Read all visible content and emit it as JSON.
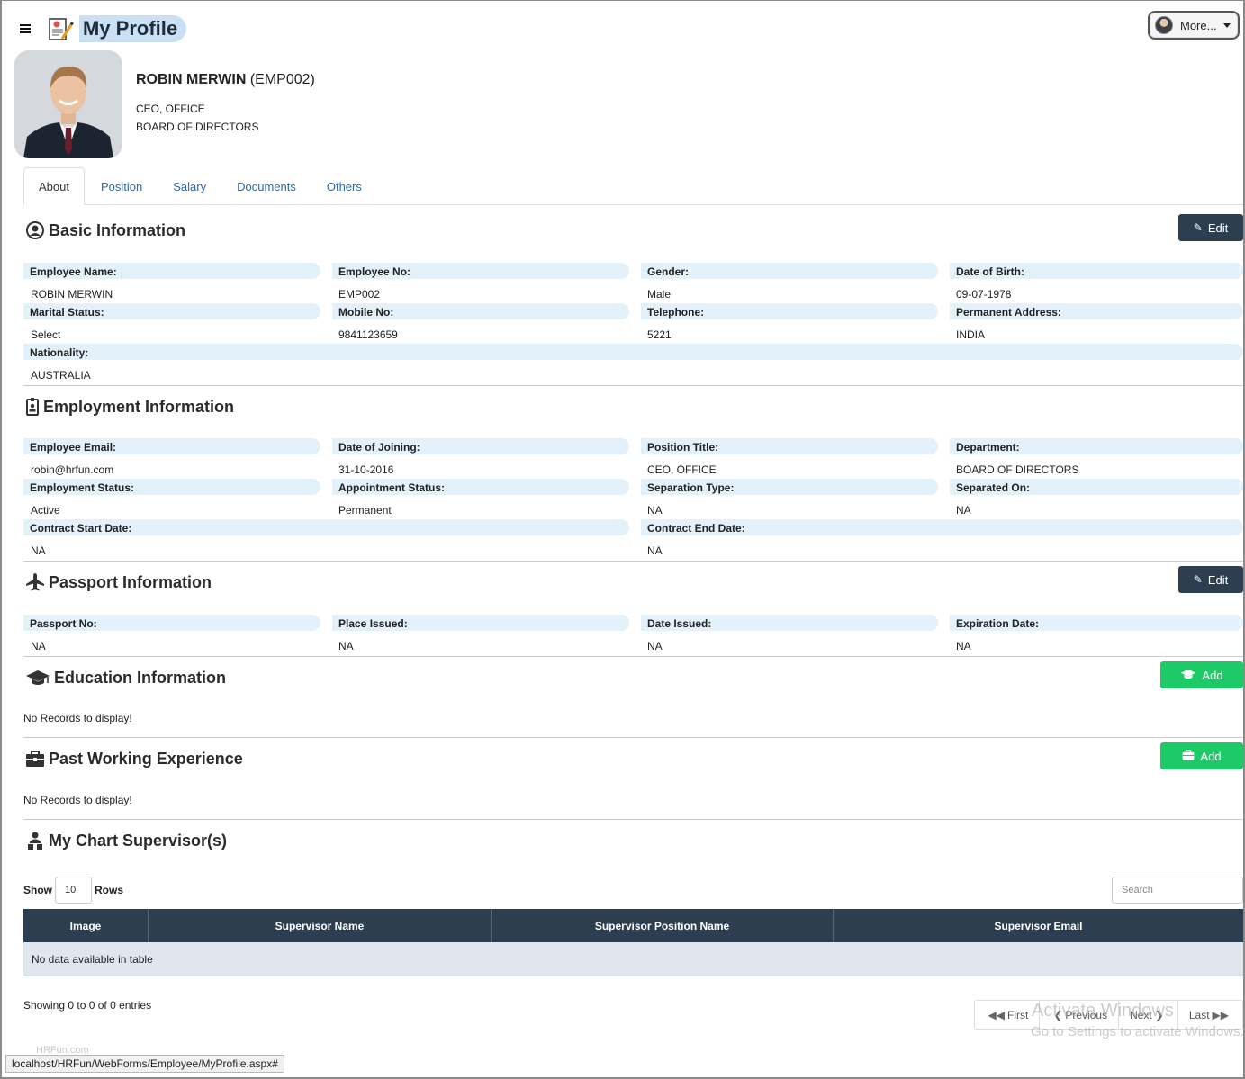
{
  "header": {
    "title": "My Profile",
    "more_label": "More..."
  },
  "profile": {
    "name": "ROBIN MERWIN",
    "emp_code": "(EMP002)",
    "position": "CEO, OFFICE",
    "department": "BOARD OF DIRECTORS"
  },
  "tabs": [
    {
      "label": "About",
      "active": true
    },
    {
      "label": "Position"
    },
    {
      "label": "Salary"
    },
    {
      "label": "Documents"
    },
    {
      "label": "Others"
    }
  ],
  "basic": {
    "title": "Basic Information",
    "edit_label": "Edit",
    "fields": [
      {
        "label": "Employee Name:",
        "value": "ROBIN MERWIN"
      },
      {
        "label": "Employee No:",
        "value": "EMP002"
      },
      {
        "label": "Gender:",
        "value": "Male"
      },
      {
        "label": "Date of Birth:",
        "value": "09-07-1978"
      },
      {
        "label": "Marital Status:",
        "value": "Select"
      },
      {
        "label": "Mobile No:",
        "value": "9841123659"
      },
      {
        "label": "Telephone:",
        "value": "5221"
      },
      {
        "label": "Permanent Address:",
        "value": "INDIA"
      },
      {
        "label": "Nationality:",
        "value": "AUSTRALIA"
      }
    ]
  },
  "employment": {
    "title": "Employment Information",
    "fields": [
      {
        "label": "Employee Email:",
        "value": "robin@hrfun.com"
      },
      {
        "label": "Date of Joining:",
        "value": "31-10-2016"
      },
      {
        "label": "Position Title:",
        "value": "CEO, OFFICE"
      },
      {
        "label": "Department:",
        "value": "BOARD OF DIRECTORS"
      },
      {
        "label": "Employment Status:",
        "value": "Active"
      },
      {
        "label": "Appointment Status:",
        "value": "Permanent"
      },
      {
        "label": "Separation Type:",
        "value": "NA"
      },
      {
        "label": "Separated On:",
        "value": "NA"
      },
      {
        "label": "Contract Start Date:",
        "value": "NA"
      },
      {
        "label": "Contract End Date:",
        "value": "NA"
      }
    ]
  },
  "passport": {
    "title": "Passport Information",
    "edit_label": "Edit",
    "fields": [
      {
        "label": "Passport No:",
        "value": "NA"
      },
      {
        "label": "Place Issued:",
        "value": "NA"
      },
      {
        "label": "Date Issued:",
        "value": "NA"
      },
      {
        "label": "Expiration Date:",
        "value": "NA"
      }
    ]
  },
  "education": {
    "title": "Education Information",
    "add_label": "Add",
    "empty": "No Records to display!"
  },
  "experience": {
    "title": "Past Working Experience",
    "add_label": "Add",
    "empty": "No Records to display!"
  },
  "supervisors": {
    "title": "My Chart Supervisor(s)",
    "show_label": "Show",
    "rows_value": "10",
    "rows_label": "Rows",
    "search_placeholder": "Search",
    "columns": [
      "Image",
      "Supervisor Name",
      "Supervisor Position Name",
      "Supervisor Email"
    ],
    "empty": "No data available in table",
    "showing": "Showing 0 to 0 of 0 entries",
    "pager": {
      "first": "First",
      "previous": "Previous",
      "next": "Next",
      "last": "Last"
    }
  },
  "overlay": {
    "watermark_line1": "Activate Windows",
    "watermark_line2": "Go to Settings to activate Windows.",
    "status_url": "localhost/HRFun/WebForms/Employee/MyProfile.aspx#",
    "footer_faded": "HRFun.com"
  },
  "colors": {
    "accent_dark": "#2d3e50",
    "add_green": "#1ec968",
    "label_bg": "#e3f1fb",
    "title_highlight": "#c9e0f5",
    "link_blue": "#2a6aad"
  },
  "icons": [
    "menu-icon",
    "profile-app-icon",
    "user-circle-icon",
    "id-badge-icon",
    "plane-icon",
    "graduation-cap-icon",
    "briefcase-icon",
    "sitemap-icon",
    "edit-icon",
    "backward-icon",
    "chevron-left-icon",
    "chevron-right-icon",
    "forward-icon"
  ]
}
